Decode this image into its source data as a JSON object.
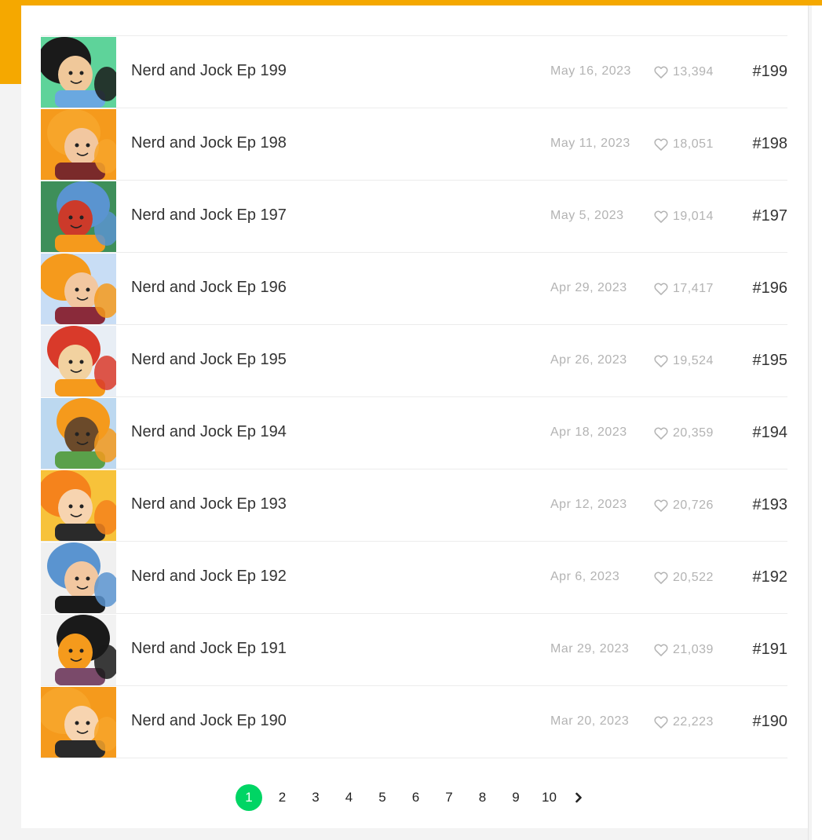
{
  "episodes": [
    {
      "title": "Nerd and Jock Ep 199",
      "date": "May 16, 2023",
      "likes": "13,394",
      "number": "#199",
      "thumb": {
        "bg": "#5ed39a",
        "a": "#1a1a1a",
        "b": "#f0c89a",
        "c": "#6aa8e0"
      }
    },
    {
      "title": "Nerd and Jock Ep 198",
      "date": "May 11, 2023",
      "likes": "18,051",
      "number": "#198",
      "thumb": {
        "bg": "#f59a1c",
        "a": "#f7a52a",
        "b": "#f2c7a0",
        "c": "#7a2a2a"
      }
    },
    {
      "title": "Nerd and Jock Ep 197",
      "date": "May 5, 2023",
      "likes": "19,014",
      "number": "#197",
      "thumb": {
        "bg": "#3e8f5a",
        "a": "#5a94d0",
        "b": "#cc3a2a",
        "c": "#f59a1c"
      }
    },
    {
      "title": "Nerd and Jock Ep 196",
      "date": "Apr 29, 2023",
      "likes": "17,417",
      "number": "#196",
      "thumb": {
        "bg": "#c8ddf5",
        "a": "#f59a1c",
        "b": "#f2c7a0",
        "c": "#8a2a3a"
      }
    },
    {
      "title": "Nerd and Jock Ep 195",
      "date": "Apr 26, 2023",
      "likes": "19,524",
      "number": "#195",
      "thumb": {
        "bg": "#e8eef5",
        "a": "#d93a2a",
        "b": "#f2d2a0",
        "c": "#f59a1c"
      }
    },
    {
      "title": "Nerd and Jock Ep 194",
      "date": "Apr 18, 2023",
      "likes": "20,359",
      "number": "#194",
      "thumb": {
        "bg": "#bcd8f0",
        "a": "#f59a1c",
        "b": "#6b4a2a",
        "c": "#5aa04a"
      }
    },
    {
      "title": "Nerd and Jock Ep 193",
      "date": "Apr 12, 2023",
      "likes": "20,726",
      "number": "#193",
      "thumb": {
        "bg": "#f7c23a",
        "a": "#f5831c",
        "b": "#f7d4b0",
        "c": "#2a2a2a"
      }
    },
    {
      "title": "Nerd and Jock Ep 192",
      "date": "Apr 6, 2023",
      "likes": "20,522",
      "number": "#192",
      "thumb": {
        "bg": "#f0f0f0",
        "a": "#5a94d0",
        "b": "#f2c7a0",
        "c": "#1a1a1a"
      }
    },
    {
      "title": "Nerd and Jock Ep 191",
      "date": "Mar 29, 2023",
      "likes": "21,039",
      "number": "#191",
      "thumb": {
        "bg": "#f2f2f2",
        "a": "#1a1a1a",
        "b": "#f59a1c",
        "c": "#7a4a6a"
      }
    },
    {
      "title": "Nerd and Jock Ep 190",
      "date": "Mar 20, 2023",
      "likes": "22,223",
      "number": "#190",
      "thumb": {
        "bg": "#f59a1c",
        "a": "#f7a52a",
        "b": "#f7d4b0",
        "c": "#2a2a2a"
      }
    }
  ],
  "pagination": {
    "pages": [
      "1",
      "2",
      "3",
      "4",
      "5",
      "6",
      "7",
      "8",
      "9",
      "10"
    ],
    "active": "1",
    "next_icon": "chevron-right-icon",
    "active_color": "#00d564"
  },
  "colors": {
    "brand": "#f5a800",
    "muted": "#b3b3b3",
    "text": "#333333"
  }
}
